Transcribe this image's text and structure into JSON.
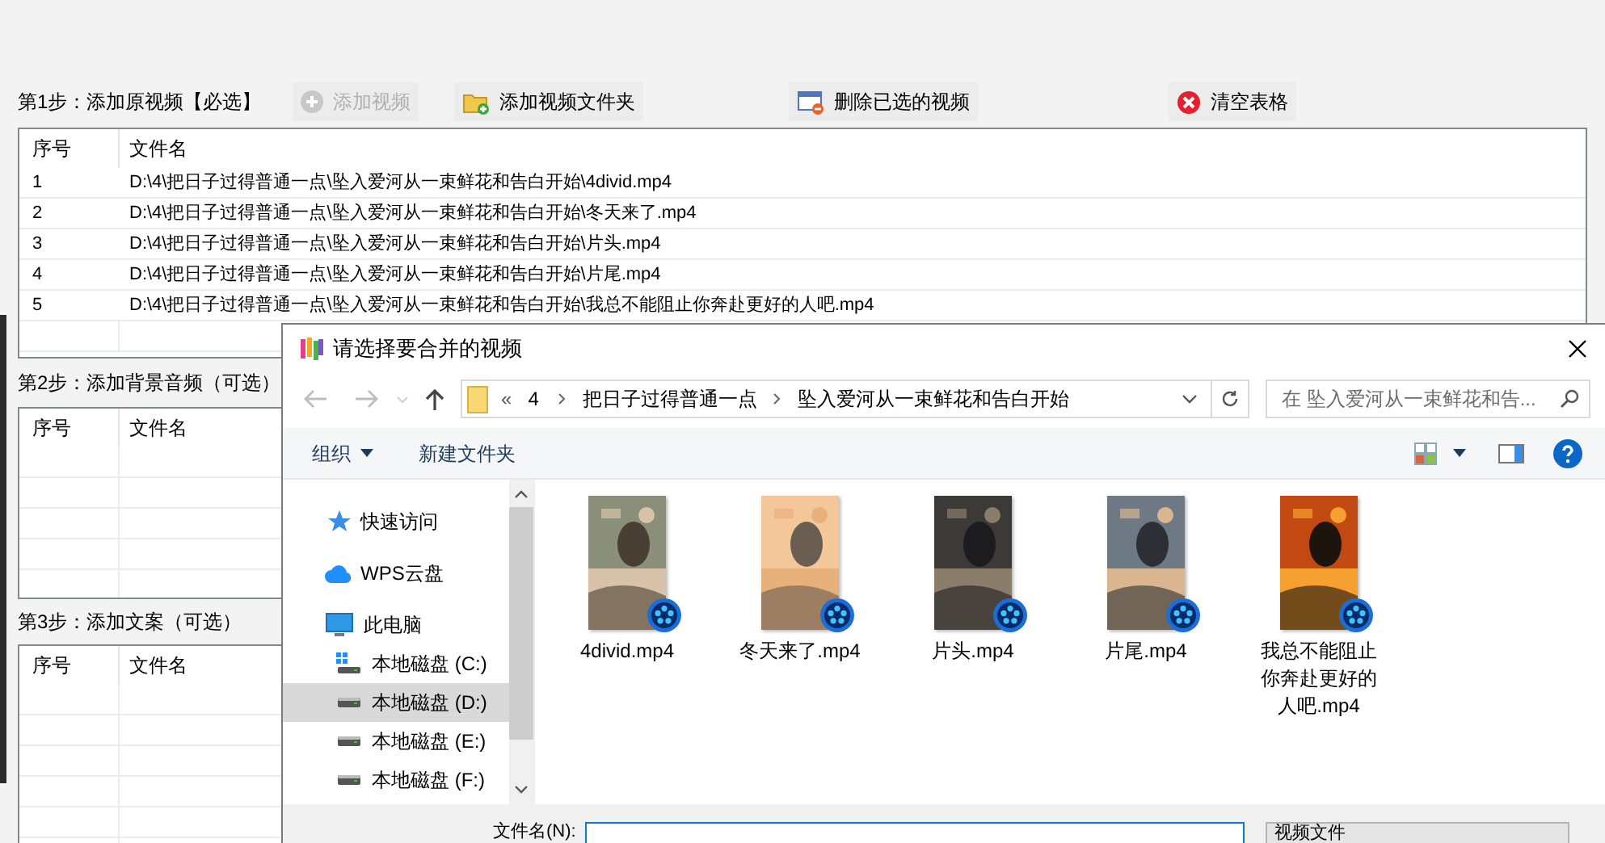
{
  "step1": {
    "label": "第1步：添加原视频【必选】",
    "buttons": [
      {
        "kind": "add",
        "label": "添加视频",
        "disabled": true
      },
      {
        "kind": "add_folder",
        "label": "添加视频文件夹",
        "disabled": false
      },
      {
        "kind": "remove",
        "label": "删除已选的视频",
        "disabled": false
      },
      {
        "kind": "clear",
        "label": "清空表格",
        "disabled": false
      }
    ],
    "table": {
      "columns": [
        "序号",
        "文件名"
      ],
      "rows": [
        {
          "index": "1",
          "path": "D:\\4\\把日子过得普通一点\\坠入爱河从一束鲜花和告白开始\\4divid.mp4"
        },
        {
          "index": "2",
          "path": "D:\\4\\把日子过得普通一点\\坠入爱河从一束鲜花和告白开始\\冬天来了.mp4"
        },
        {
          "index": "3",
          "path": "D:\\4\\把日子过得普通一点\\坠入爱河从一束鲜花和告白开始\\片头.mp4"
        },
        {
          "index": "4",
          "path": "D:\\4\\把日子过得普通一点\\坠入爱河从一束鲜花和告白开始\\片尾.mp4"
        },
        {
          "index": "5",
          "path": "D:\\4\\把日子过得普通一点\\坠入爱河从一束鲜花和告白开始\\我总不能阻止你奔赴更好的人吧.mp4"
        }
      ]
    }
  },
  "step2": {
    "label": "第2步：添加背景音频（可选）",
    "table": {
      "columns": [
        "序号",
        "文件名"
      ]
    }
  },
  "step3": {
    "label": "第3步：添加文案（可选）",
    "table": {
      "columns": [
        "序号",
        "文件名"
      ]
    }
  },
  "dialog": {
    "title": "请选择要合并的视频",
    "breadcrumb": {
      "overflow": "«",
      "parts": [
        "4",
        "把日子过得普通一点",
        "坠入爱河从一束鲜花和告白开始"
      ]
    },
    "search": {
      "placeholder": "在 坠入爱河从一束鲜花和告..."
    },
    "toolbar": [
      {
        "kind": "menu",
        "label": "组织"
      },
      {
        "kind": "button",
        "label": "新建文件夹"
      }
    ],
    "nav": [
      {
        "kind": "star",
        "label": "快速访问",
        "selected": false
      },
      {
        "kind": "cloud",
        "label": "WPS云盘",
        "selected": false
      },
      {
        "kind": "pc",
        "label": "此电脑",
        "selected": false,
        "children": [
          {
            "kind": "system_drive",
            "label": "本地磁盘 (C:)",
            "selected": false
          },
          {
            "kind": "drive",
            "label": "本地磁盘 (D:)",
            "selected": true
          },
          {
            "kind": "drive",
            "label": "本地磁盘 (E:)",
            "selected": false
          },
          {
            "kind": "drive",
            "label": "本地磁盘 (F:)",
            "selected": false
          }
        ]
      }
    ],
    "files": [
      {
        "name": "4divid.mp4"
      },
      {
        "name": "冬天来了.mp4"
      },
      {
        "name": "片头.mp4"
      },
      {
        "name": "片尾.mp4"
      },
      {
        "name": "我总不能阻止你奔赴更好的人吧.mp4"
      }
    ],
    "footer": {
      "filename_label": "文件名(N):",
      "filter": "视频文件"
    }
  }
}
